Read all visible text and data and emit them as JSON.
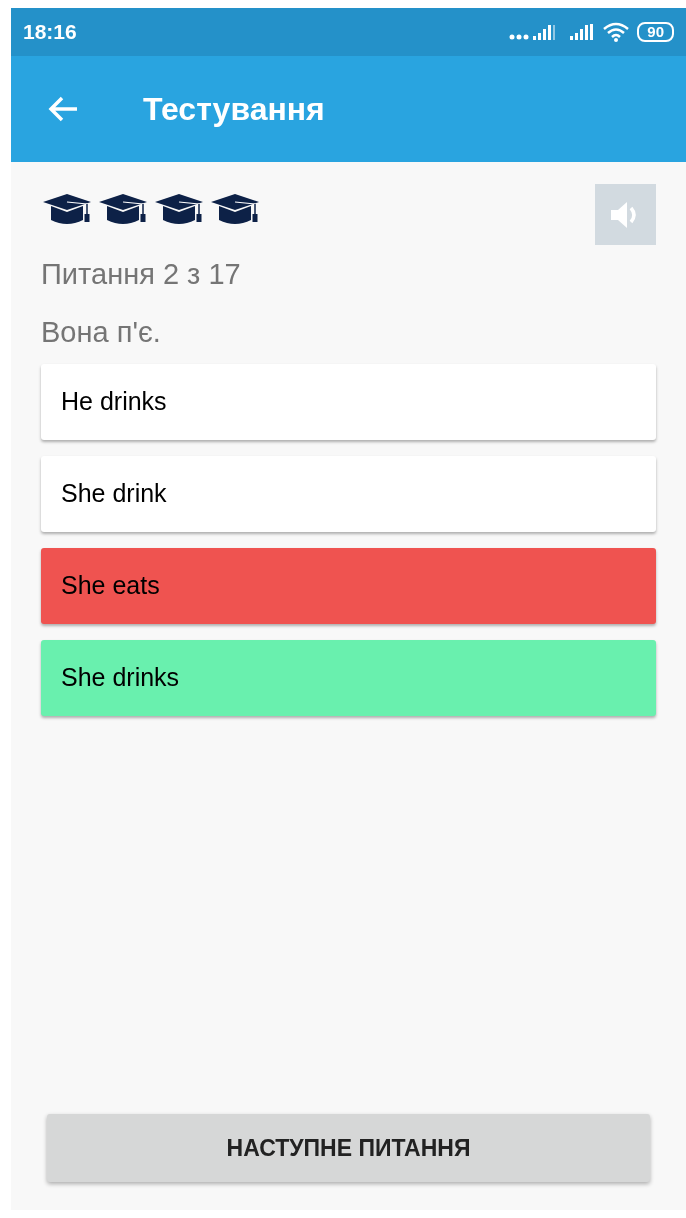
{
  "status_bar": {
    "time": "18:16",
    "battery": "90"
  },
  "app_bar": {
    "title": "Тестування"
  },
  "question_counter": "Питання 2 з 17",
  "question": "Вона п'є.",
  "answers": [
    {
      "text": "He drinks",
      "kind": "plain"
    },
    {
      "text": "She drink",
      "kind": "plain"
    },
    {
      "text": "She eats",
      "kind": "wrong"
    },
    {
      "text": "She drinks",
      "kind": "correct"
    }
  ],
  "next_button": "НАСТУПНЕ ПИТАННЯ"
}
